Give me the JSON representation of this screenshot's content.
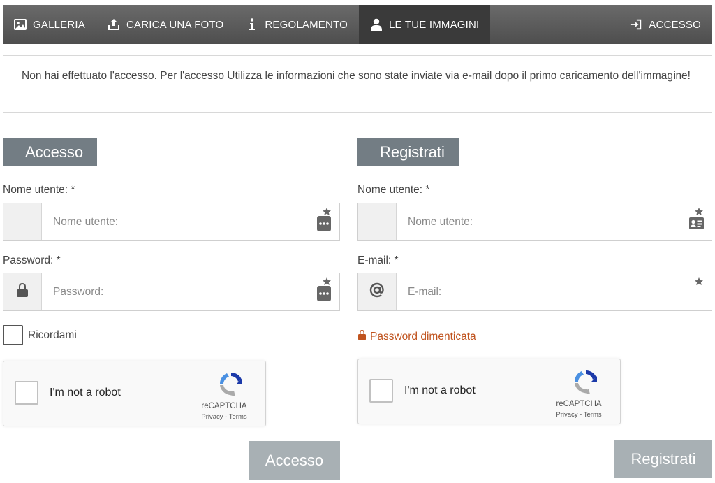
{
  "nav": {
    "items": [
      {
        "label": "GALLERIA",
        "icon": "image-icon"
      },
      {
        "label": "CARICA UNA FOTO",
        "icon": "upload-icon"
      },
      {
        "label": "REGOLAMENTO",
        "icon": "info-icon"
      },
      {
        "label": "LE TUE IMMAGINI",
        "icon": "user-icon",
        "active": true
      }
    ],
    "login": {
      "label": "ACCESSO",
      "icon": "sign-in-icon"
    }
  },
  "notice": "Non hai effettuato l'accesso. Per l'accesso Utilizza le informazioni che sono state inviate via e-mail dopo il primo caricamento dell'immagine!",
  "login_form": {
    "title": "Accesso",
    "username_label": "Nome utente: *",
    "username_placeholder": "Nome utente:",
    "password_label": "Password: *",
    "password_placeholder": "Password:",
    "remember_label": "Ricordami",
    "submit_label": "Accesso"
  },
  "register_form": {
    "title": "Registrati",
    "username_label": "Nome utente: *",
    "username_placeholder": "Nome utente:",
    "email_label": "E-mail: *",
    "email_placeholder": "E-mail:",
    "forgot_label": "Password dimenticata",
    "submit_label": "Registrati"
  },
  "recaptcha": {
    "label": "I'm not a robot",
    "brand": "reCAPTCHA",
    "links": "Privacy - Terms"
  },
  "colors": {
    "nav_bg": "#5a5a5a",
    "nav_active": "#3a3a3a",
    "section_title_bg": "#737d84",
    "submit_bg": "#a8b0b4",
    "forgot_link": "#c0531e"
  }
}
